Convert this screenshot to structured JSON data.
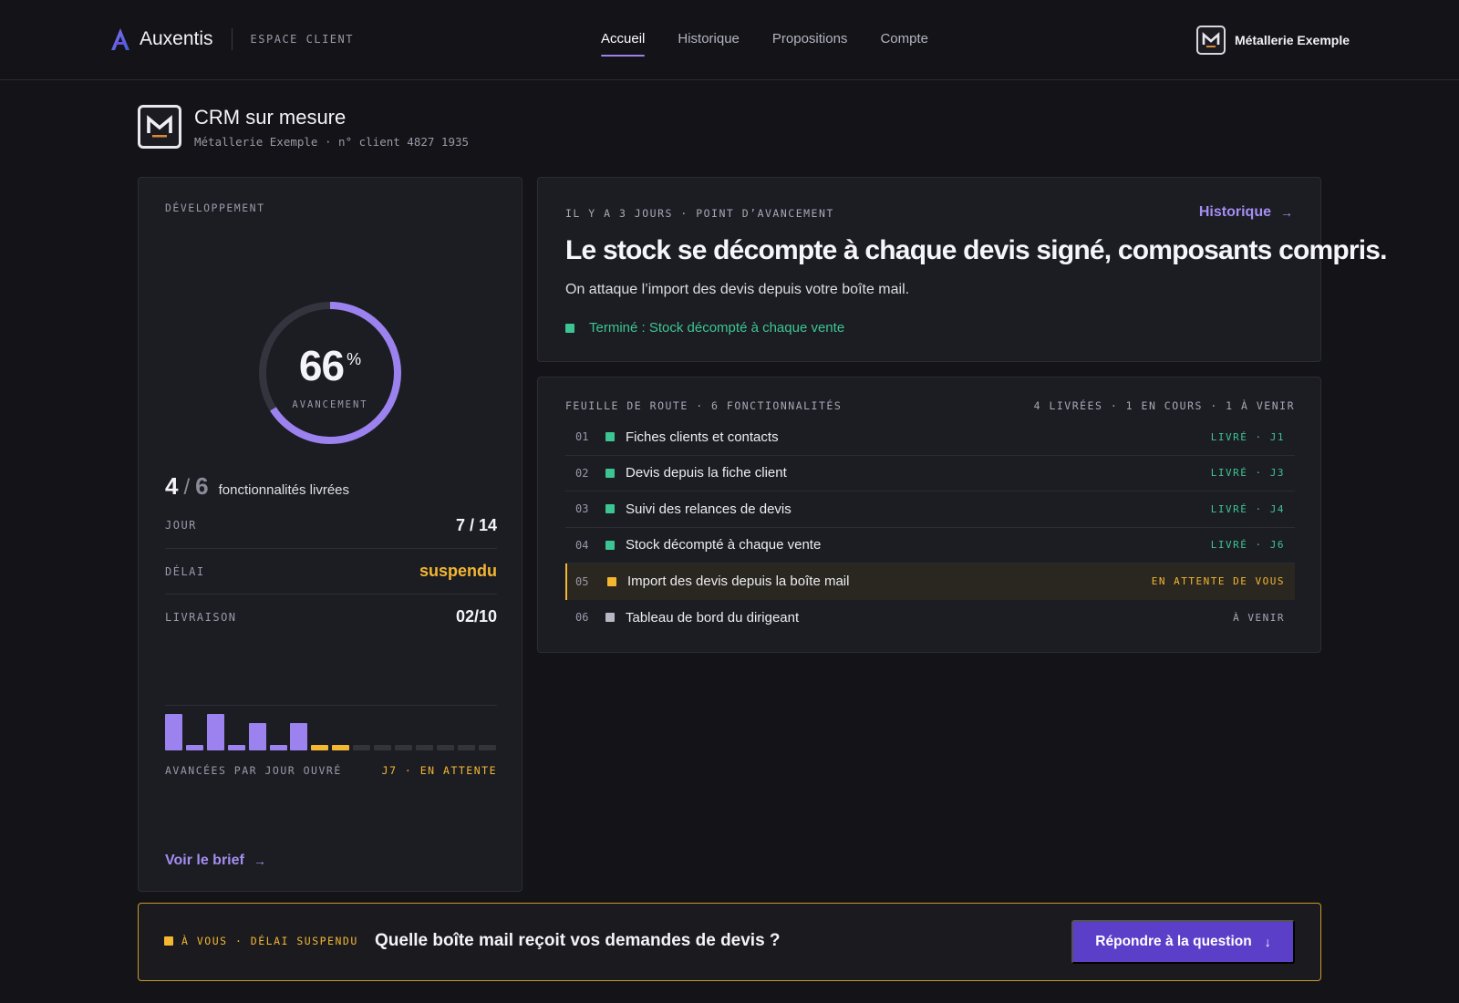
{
  "colors": {
    "accent": "#9b82ee",
    "accent_link": "#a48ef0",
    "success": "#3cc592",
    "warning": "#f3b731",
    "muted": "#b8b8c4",
    "button": "#5b3fc9"
  },
  "topbar": {
    "brand_name": "Auxentis",
    "brand_icon": "auxentis-logo-icon",
    "space_label": "ESPACE CLIENT",
    "nav": [
      {
        "label": "Accueil",
        "active": true
      },
      {
        "label": "Historique",
        "active": false
      },
      {
        "label": "Propositions",
        "active": false
      },
      {
        "label": "Compte",
        "active": false
      }
    ],
    "account_name": "Métallerie Exemple",
    "account_icon": "company-logo-icon"
  },
  "header": {
    "title": "CRM sur mesure",
    "subtitle": "Métallerie Exemple · n° client 4827 1935"
  },
  "dev": {
    "section_label": "DÉVELOPPEMENT",
    "progress_pct": 66,
    "progress_number": "66",
    "progress_symbol": "%",
    "progress_label": "AVANCEMENT",
    "delivered_count": "4",
    "delivered_slash": "/",
    "total_count": "6",
    "delivered_text": "fonctionnalités livrées",
    "stats": [
      {
        "key": "JOUR",
        "value": "7 / 14",
        "status": "normal"
      },
      {
        "key": "DÉLAI",
        "value": "suspendu",
        "status": "warning"
      },
      {
        "key": "LIVRAISON",
        "value": "02/10",
        "status": "normal"
      }
    ],
    "daily_progress": [
      {
        "value": 1.0,
        "status": "done"
      },
      {
        "value": 0.15,
        "status": "done"
      },
      {
        "value": 1.0,
        "status": "done"
      },
      {
        "value": 0.15,
        "status": "done"
      },
      {
        "value": 0.75,
        "status": "done"
      },
      {
        "value": 0.15,
        "status": "done"
      },
      {
        "value": 0.75,
        "status": "done"
      },
      {
        "value": 0.15,
        "status": "waiting"
      },
      {
        "value": 0.15,
        "status": "waiting"
      },
      {
        "value": 0.15,
        "status": "future"
      },
      {
        "value": 0.15,
        "status": "future"
      },
      {
        "value": 0.15,
        "status": "future"
      },
      {
        "value": 0.15,
        "status": "future"
      },
      {
        "value": 0.15,
        "status": "future"
      },
      {
        "value": 0.15,
        "status": "future"
      },
      {
        "value": 0.15,
        "status": "future"
      }
    ],
    "bars_caption": "AVANCÉES PAR JOUR OUVRÉ",
    "bars_status": "J7 · EN ATTENTE",
    "brief_link": "Voir le brief",
    "arrow_icon": "arrow-right-icon"
  },
  "update": {
    "meta": "IL Y A 3 JOURS · POINT D’AVANCEMENT",
    "history_link": "Historique",
    "title": "Le stock se décompte à chaque devis signé, composants compris.",
    "text": "On attaque l’import des devis depuis votre boîte mail.",
    "done": "Terminé : Stock décompté à chaque vente"
  },
  "roadmap": {
    "title": "FEUILLE DE ROUTE · 6 FONCTIONNALITÉS",
    "summary": "4 LIVRÉES · 1 EN COURS · 1 À VENIR",
    "items": [
      {
        "num": "01",
        "name": "Fiches clients et contacts",
        "status": "LIVRÉ · J1",
        "state": "done"
      },
      {
        "num": "02",
        "name": "Devis depuis la fiche client",
        "status": "LIVRÉ · J3",
        "state": "done"
      },
      {
        "num": "03",
        "name": "Suivi des relances de devis",
        "status": "LIVRÉ · J4",
        "state": "done"
      },
      {
        "num": "04",
        "name": "Stock décompté à chaque vente",
        "status": "LIVRÉ · J6",
        "state": "done"
      },
      {
        "num": "05",
        "name": "Import des devis depuis la boîte mail",
        "status": "EN ATTENTE DE VOUS",
        "state": "waiting"
      },
      {
        "num": "06",
        "name": "Tableau de bord du dirigeant",
        "status": "À VENIR",
        "state": "future"
      }
    ]
  },
  "banner": {
    "tag": "À VOUS · DÉLAI SUSPENDU",
    "question": "Quelle boîte mail reçoit vos demandes de devis ?",
    "button": "Répondre à la question",
    "button_icon": "arrow-down-icon"
  }
}
